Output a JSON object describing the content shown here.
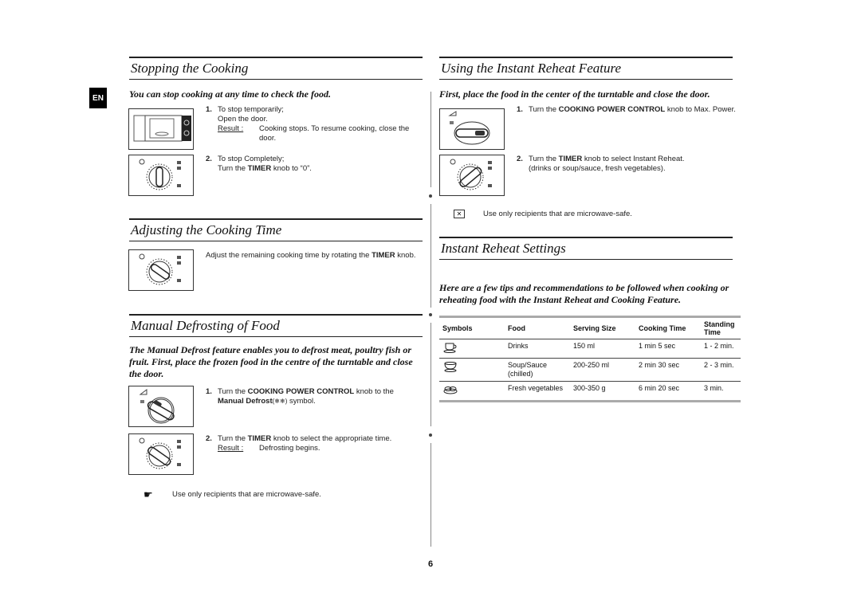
{
  "language_tab": "EN",
  "page_number": "6",
  "stopping": {
    "title": "Stopping the Cooking",
    "lead": "You can stop cooking at any time to check the food.",
    "step1_num": "1.",
    "step1_line1": "To stop temporarily;",
    "step1_line2": "Open the door.",
    "step1_result_label": "Result :",
    "step1_result_text": "Cooking stops. To resume cooking, close the door.",
    "step2_num": "2.",
    "step2_line1": "To stop Completely;",
    "step2_line2_pre": "Turn the ",
    "step2_line2_bold": "TIMER",
    "step2_line2_post": " knob to “0”."
  },
  "adjusting": {
    "title": "Adjusting the Cooking Time",
    "text_pre": "Adjust the remaining cooking time by rotating the ",
    "text_bold": "TIMER",
    "text_post": " knob."
  },
  "defrost": {
    "title": "Manual Defrosting of Food",
    "lead": "The Manual Defrost feature enables you to defrost meat, poultry fish or fruit. First, place the frozen food in the centre of the turntable and close the door.",
    "step1_num": "1.",
    "step1_pre": "Turn the ",
    "step1_bold": "COOKING POWER CONTROL",
    "step1_post": " knob to the",
    "step1_line2_bold": "Manual Defrost",
    "step1_line2_post": " symbol.",
    "step2_num": "2.",
    "step2_pre": "Turn the ",
    "step2_bold": "TIMER",
    "step2_post": " knob to select the appropriate time.",
    "step2_result_label": "Result :",
    "step2_result_text": "Defrosting begins.",
    "note": "Use only recipients that are microwave-safe."
  },
  "reheat": {
    "title": "Using the Instant Reheat Feature",
    "lead": "First, place the food in the center of the turntable and close the door.",
    "step1_num": "1.",
    "step1_pre": "Turn the ",
    "step1_bold": "COOKING POWER CONTROL",
    "step1_post": " knob to Max. Power.",
    "step2_num": "2.",
    "step2_pre": "Turn the ",
    "step2_bold": "TIMER",
    "step2_post": " knob to select Instant Reheat.",
    "step2_line2": "(drinks or soup/sauce, fresh vegetables).",
    "note": "Use only recipients that are microwave-safe."
  },
  "settings": {
    "title": "Instant Reheat Settings",
    "lead": "Here are a few tips and recommendations to be followed when cooking or reheating food with the Instant Reheat and Cooking Feature.",
    "headers": [
      "Symbols",
      "Food",
      "Serving Size",
      "Cooking Time",
      "Standing Time"
    ],
    "rows": [
      {
        "icon": "cup-icon",
        "food": "Drinks",
        "size": "150 ml",
        "time": "1 min 5 sec",
        "standing": "1 - 2 min."
      },
      {
        "icon": "bowl-icon",
        "food": "Soup/Sauce (chilled)",
        "size": "200-250 ml",
        "time": "2 min 30 sec",
        "standing": "2 - 3 min."
      },
      {
        "icon": "vegetables-icon",
        "food": "Fresh vegetables",
        "size": "300-350 g",
        "time": "6 min 20 sec",
        "standing": "3 min."
      }
    ]
  }
}
